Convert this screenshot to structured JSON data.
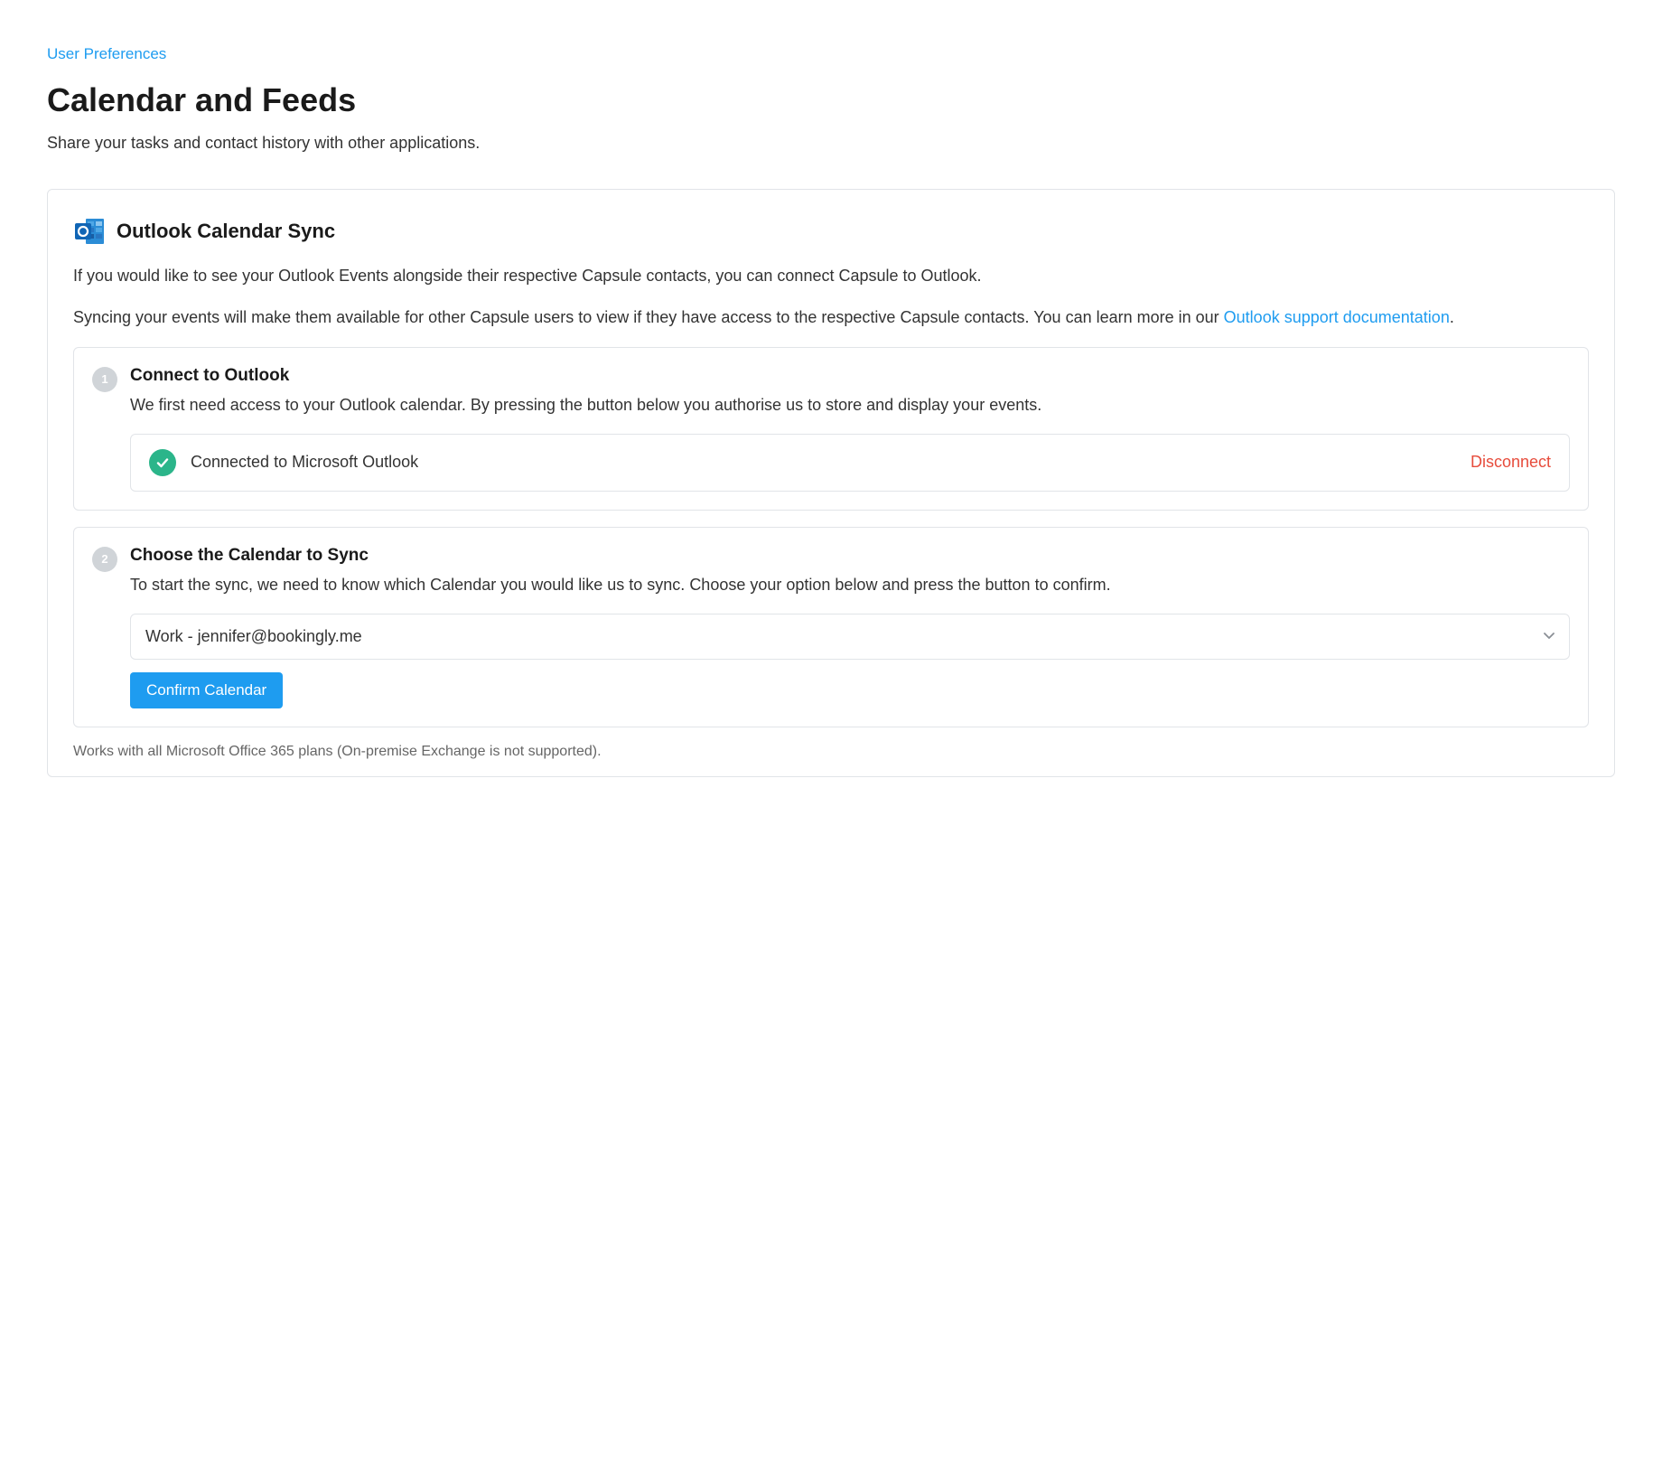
{
  "breadcrumb": {
    "label": "User Preferences"
  },
  "page": {
    "title": "Calendar and Feeds",
    "subtitle": "Share your tasks and contact history with other applications."
  },
  "sync_card": {
    "title": "Outlook Calendar Sync",
    "desc1": "If you would like to see your Outlook Events alongside their respective Capsule contacts, you can connect Capsule to Outlook.",
    "desc2_prefix": "Syncing your events will make them available for other Capsule users to view if they have access to the respective Capsule contacts. You can learn more in our ",
    "desc2_link": "Outlook support documentation",
    "desc2_suffix": ".",
    "steps": [
      {
        "num": "1",
        "title": "Connect to Outlook",
        "desc": "We first need access to your Outlook calendar. By pressing the button below you authorise us to store and display your events.",
        "status_text": "Connected to Microsoft Outlook",
        "disconnect_label": "Disconnect"
      },
      {
        "num": "2",
        "title": "Choose the Calendar to Sync",
        "desc": "To start the sync, we need to know which Calendar you would like us to sync. Choose your option below and press the button to confirm.",
        "selected_calendar": "Work - jennifer@bookingly.me",
        "confirm_label": "Confirm Calendar"
      }
    ],
    "footer_note": "Works with all Microsoft Office 365 plans (On-premise Exchange is not supported)."
  },
  "colors": {
    "link": "#1e9cf0",
    "danger": "#e74c3c",
    "success": "#2bb58a"
  }
}
